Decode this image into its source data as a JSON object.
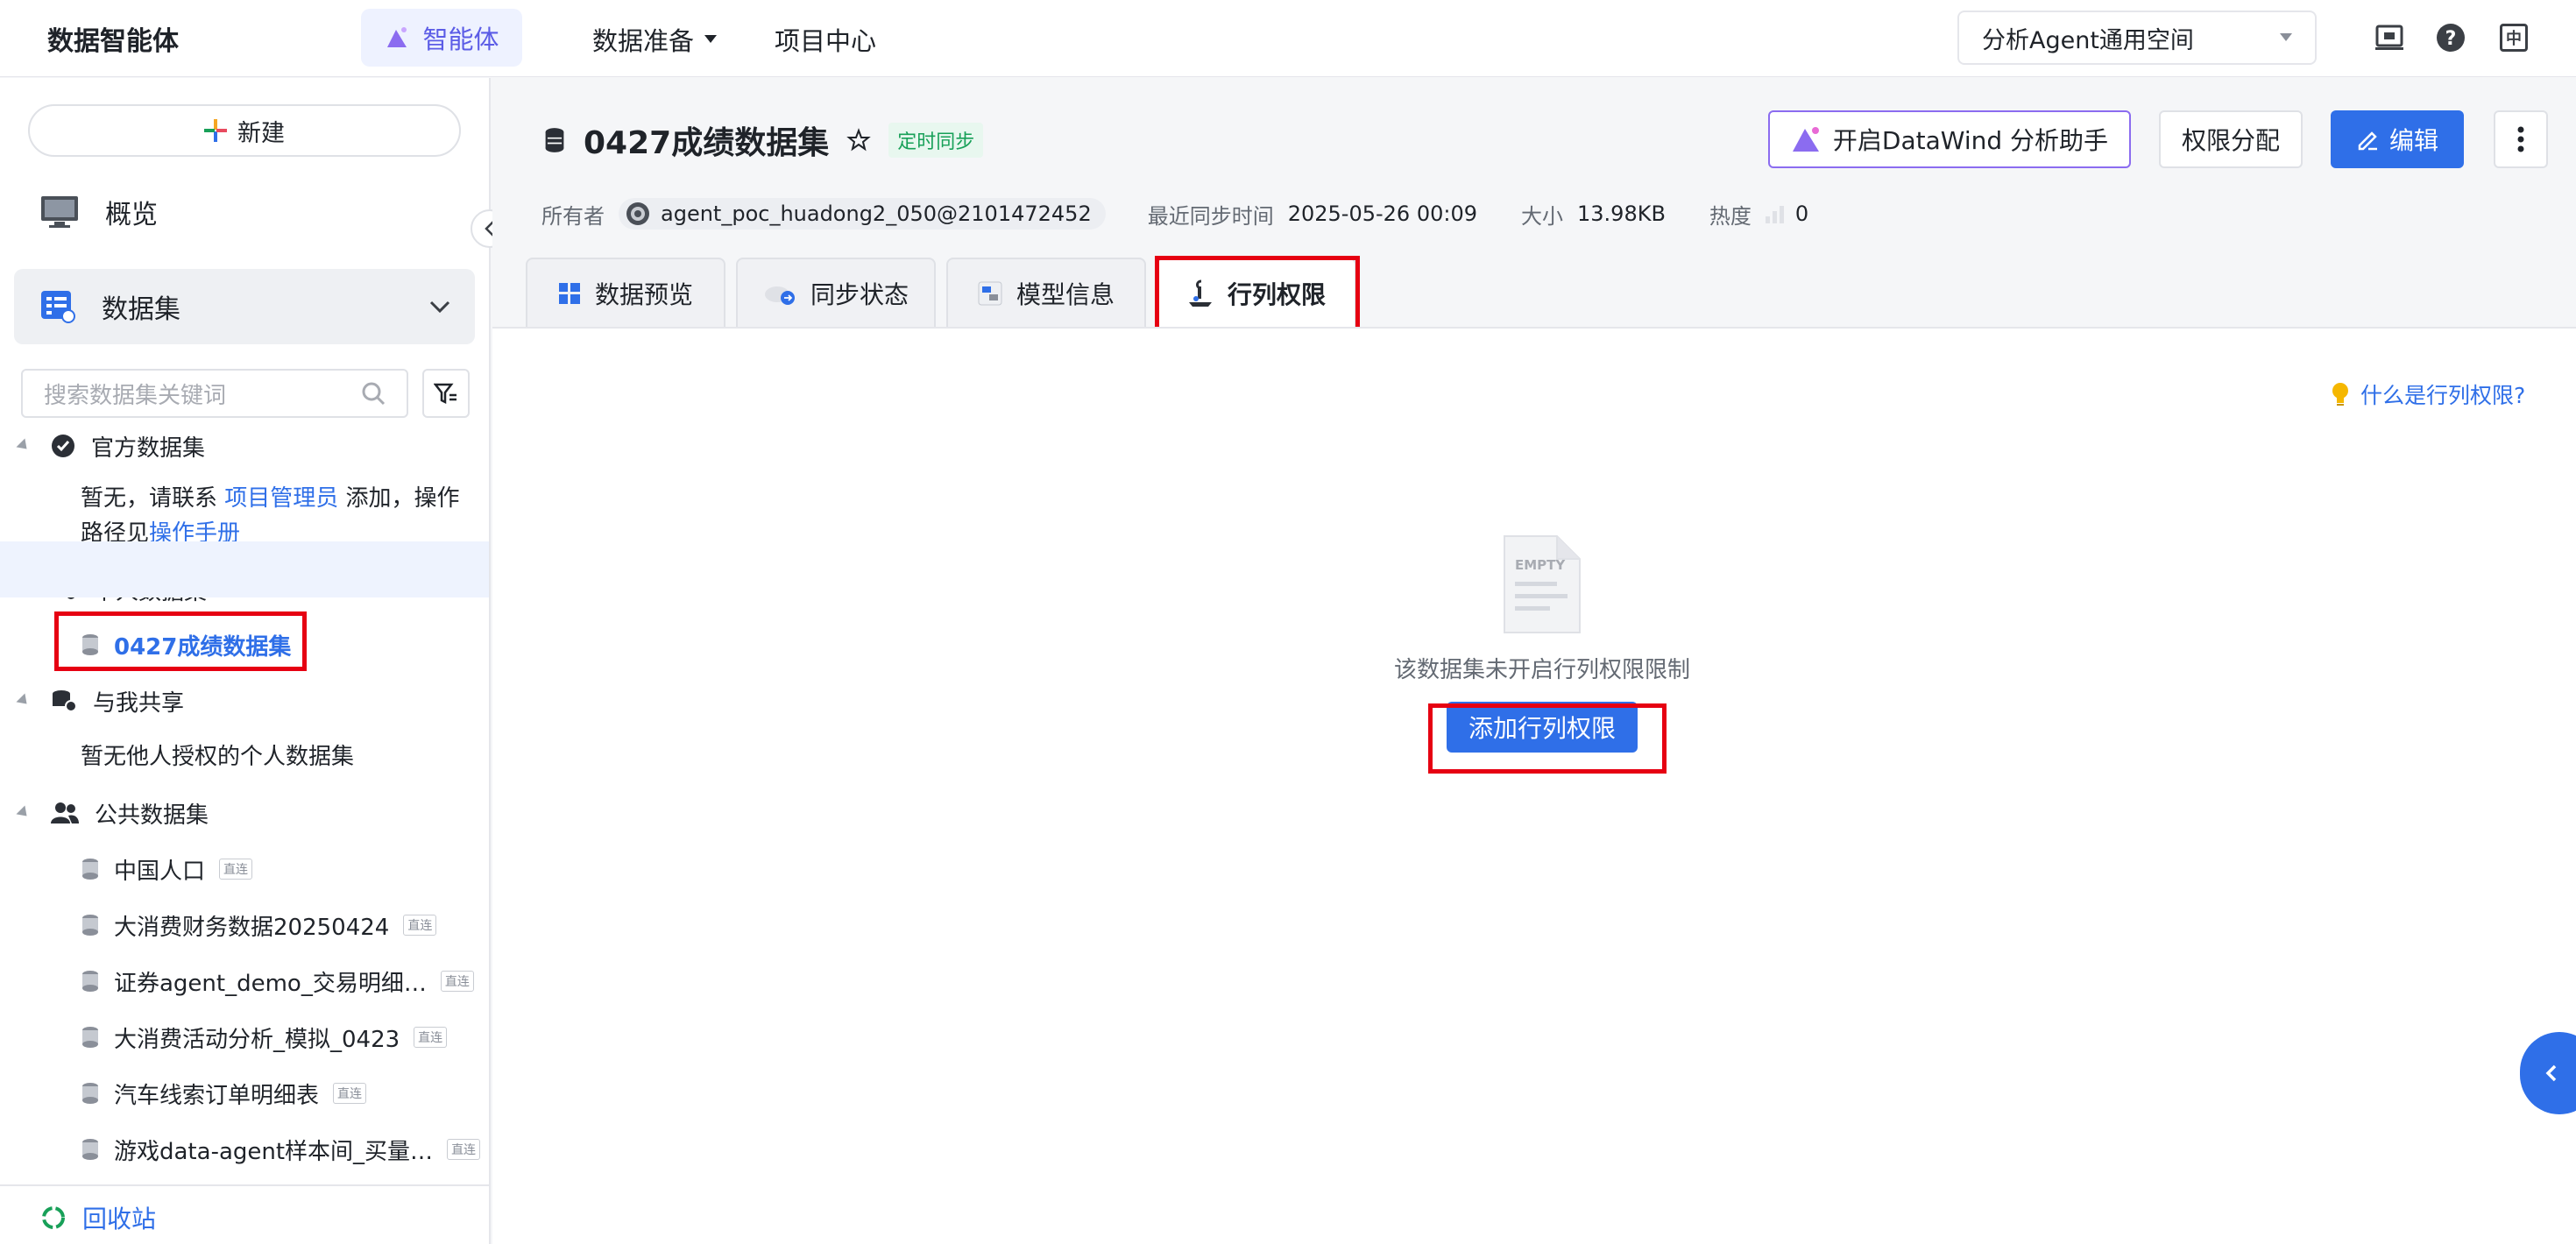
{
  "topbar": {
    "brand": "数据智能体",
    "nav": {
      "agent": "智能体",
      "data_prep": "数据准备",
      "project": "项目中心"
    },
    "workspace": "分析Agent通用空间",
    "lang_icon_label": "中"
  },
  "sidebar": {
    "new_label": "新建",
    "menu": [
      {
        "label": "概览"
      },
      {
        "label": "数据集"
      }
    ],
    "search_placeholder": "搜索数据集关键词",
    "groups": {
      "official": {
        "label": "官方数据集",
        "note_prefix": "暂无，请联系 ",
        "note_link1": "项目管理员",
        "note_mid": " 添加，操作路径见",
        "note_link2": "操作手册"
      },
      "personal": {
        "label": "个人数据集",
        "items": [
          "0427成绩数据集"
        ]
      },
      "shared": {
        "label": "与我共享",
        "note": "暂无他人授权的个人数据集"
      },
      "public": {
        "label": "公共数据集",
        "items": [
          {
            "name": "中国人口",
            "tag": "直连"
          },
          {
            "name": "大消费财务数据20250424",
            "tag": "直连"
          },
          {
            "name": "证券agent_demo_交易明细…",
            "tag": "直连"
          },
          {
            "name": "大消费活动分析_模拟_0423",
            "tag": "直连"
          },
          {
            "name": "汽车线索订单明细表",
            "tag": "直连"
          },
          {
            "name": "游戏data-agent样本间_买量…",
            "tag": "直连"
          }
        ]
      }
    },
    "recycle": "回收站"
  },
  "dataset": {
    "title": "0427成绩数据集",
    "sync_badge": "定时同步",
    "meta": {
      "owner_label": "所有者",
      "owner": "agent_poc_huadong2_050@2101472452",
      "sync_label": "最近同步时间",
      "sync_time": "2025-05-26 00:09",
      "size_label": "大小",
      "size": "13.98KB",
      "heat_label": "热度",
      "heat": "0"
    },
    "actions": {
      "assistant": "开启DataWind 分析助手",
      "permission": "权限分配",
      "edit": "编辑"
    },
    "tabs": [
      "数据预览",
      "同步状态",
      "模型信息",
      "行列权限"
    ]
  },
  "content": {
    "help_link": "什么是行列权限?",
    "empty_label": "EMPTY",
    "empty_text": "该数据集未开启行列权限限制",
    "add_button": "添加行列权限"
  },
  "colors": {
    "accent": "#2f6fe8",
    "highlight": "#e60012",
    "assistant_border": "#8b6cf0"
  }
}
